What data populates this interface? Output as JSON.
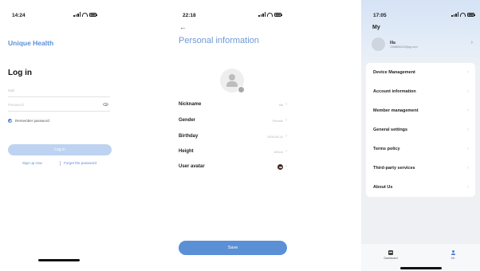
{
  "screens": {
    "login": {
      "status_time": "14:24",
      "brand": "Unique Health",
      "title": "Log in",
      "username_placeholder": "Mail",
      "password_placeholder": "Password",
      "remember_label": "Remember password",
      "login_button": "Log in",
      "signup_link": "Sign up now",
      "forgot_link": "Forget the password"
    },
    "personal": {
      "status_time": "22:18",
      "back_glyph": "←",
      "title": "Personal information",
      "rows": [
        {
          "label": "Nickname",
          "value": "Illa"
        },
        {
          "label": "Gender",
          "value": "Female"
        },
        {
          "label": "Birthday",
          "value": "2005.06.10"
        },
        {
          "label": "Height",
          "value": "160cm"
        },
        {
          "label": "User avatar",
          "value": ""
        }
      ],
      "save_button": "Save"
    },
    "my": {
      "status_time": "17:05",
      "title": "My",
      "user_name": "Illa",
      "user_email": "1068804412@qq.com",
      "menu": [
        "Device Management",
        "Account information",
        "Member management",
        "General settings",
        "Terms policy",
        "Third-party services",
        "About Us"
      ],
      "tabs": [
        {
          "label": "Dashboard",
          "icon": "dashboard-icon",
          "active": false
        },
        {
          "label": "Me",
          "icon": "me-icon",
          "active": true
        }
      ]
    }
  },
  "chevron_glyph": "›",
  "colors": {
    "accent": "#5b8fd6",
    "accent_light": "#bdd3f1",
    "active_tab": "#4a7bd0",
    "my_background": "#eef0f4"
  }
}
